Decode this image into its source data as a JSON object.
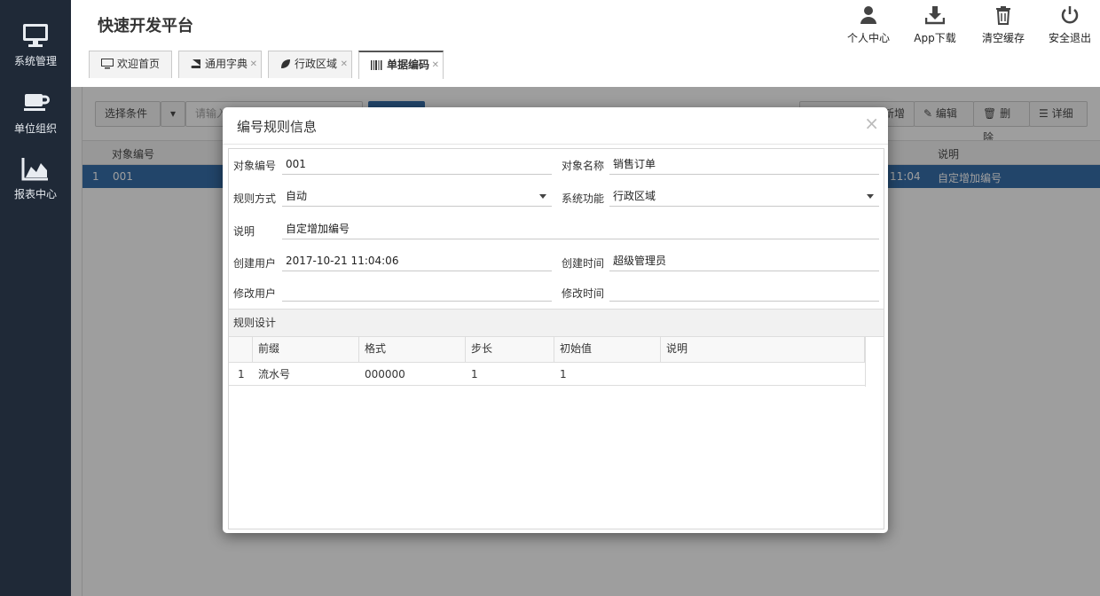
{
  "app": {
    "title": "快速开发平台"
  },
  "leftnav": {
    "items": [
      {
        "label": "系统管理",
        "icon": "monitor-icon"
      },
      {
        "label": "单位组织",
        "icon": "coffee-cup-icon"
      },
      {
        "label": "报表中心",
        "icon": "area-chart-icon"
      }
    ]
  },
  "header": {
    "actions": [
      {
        "label": "个人中心",
        "icon": "user-icon"
      },
      {
        "label": "App下载",
        "icon": "download-icon"
      },
      {
        "label": "清空缓存",
        "icon": "trash-icon"
      },
      {
        "label": "安全退出",
        "icon": "power-icon"
      }
    ]
  },
  "tabs": [
    {
      "label": "欢迎首页",
      "icon": "monitor-icon",
      "closable": false
    },
    {
      "label": "通用字典",
      "icon": "book-icon",
      "closable": true
    },
    {
      "label": "行政区域",
      "icon": "leaf-icon",
      "closable": true
    },
    {
      "label": "单据编码",
      "icon": "barcode-icon",
      "closable": true,
      "active": true
    }
  ],
  "toolbar": {
    "condition_label": "选择条件",
    "search_placeholder": "请输入",
    "add_label": "新增",
    "edit_label": "编辑",
    "delete_label": "删除",
    "detail_label": "详细"
  },
  "grid": {
    "col_code": "对象编号",
    "col_desc": "说明",
    "row": {
      "index": "1",
      "code": "001",
      "time_tail": "11:04",
      "desc": "自定增加编号"
    }
  },
  "dialog": {
    "title": "编号规则信息",
    "close": "×",
    "fields": {
      "object_code": {
        "label": "对象编号",
        "value": "001"
      },
      "object_name": {
        "label": "对象名称",
        "value": "销售订单"
      },
      "rule_mode": {
        "label": "规则方式",
        "value": "自动"
      },
      "system_function": {
        "label": "系统功能",
        "value": "行政区域"
      },
      "description": {
        "label": "说明",
        "value": "自定增加编号"
      },
      "create_user": {
        "label": "创建用户",
        "value": "2017-10-21 11:04:06"
      },
      "create_time": {
        "label": "创建时间",
        "value": "超级管理员"
      },
      "modify_user": {
        "label": "修改用户",
        "value": ""
      },
      "modify_time": {
        "label": "修改时间",
        "value": ""
      }
    },
    "rule_section": {
      "title": "规则设计",
      "columns": [
        "前缀",
        "格式",
        "步长",
        "初始值",
        "说明"
      ],
      "rows": [
        {
          "index": "1",
          "prefix": "流水号",
          "format": "000000",
          "step": "1",
          "initial": "1",
          "desc": ""
        }
      ]
    }
  }
}
